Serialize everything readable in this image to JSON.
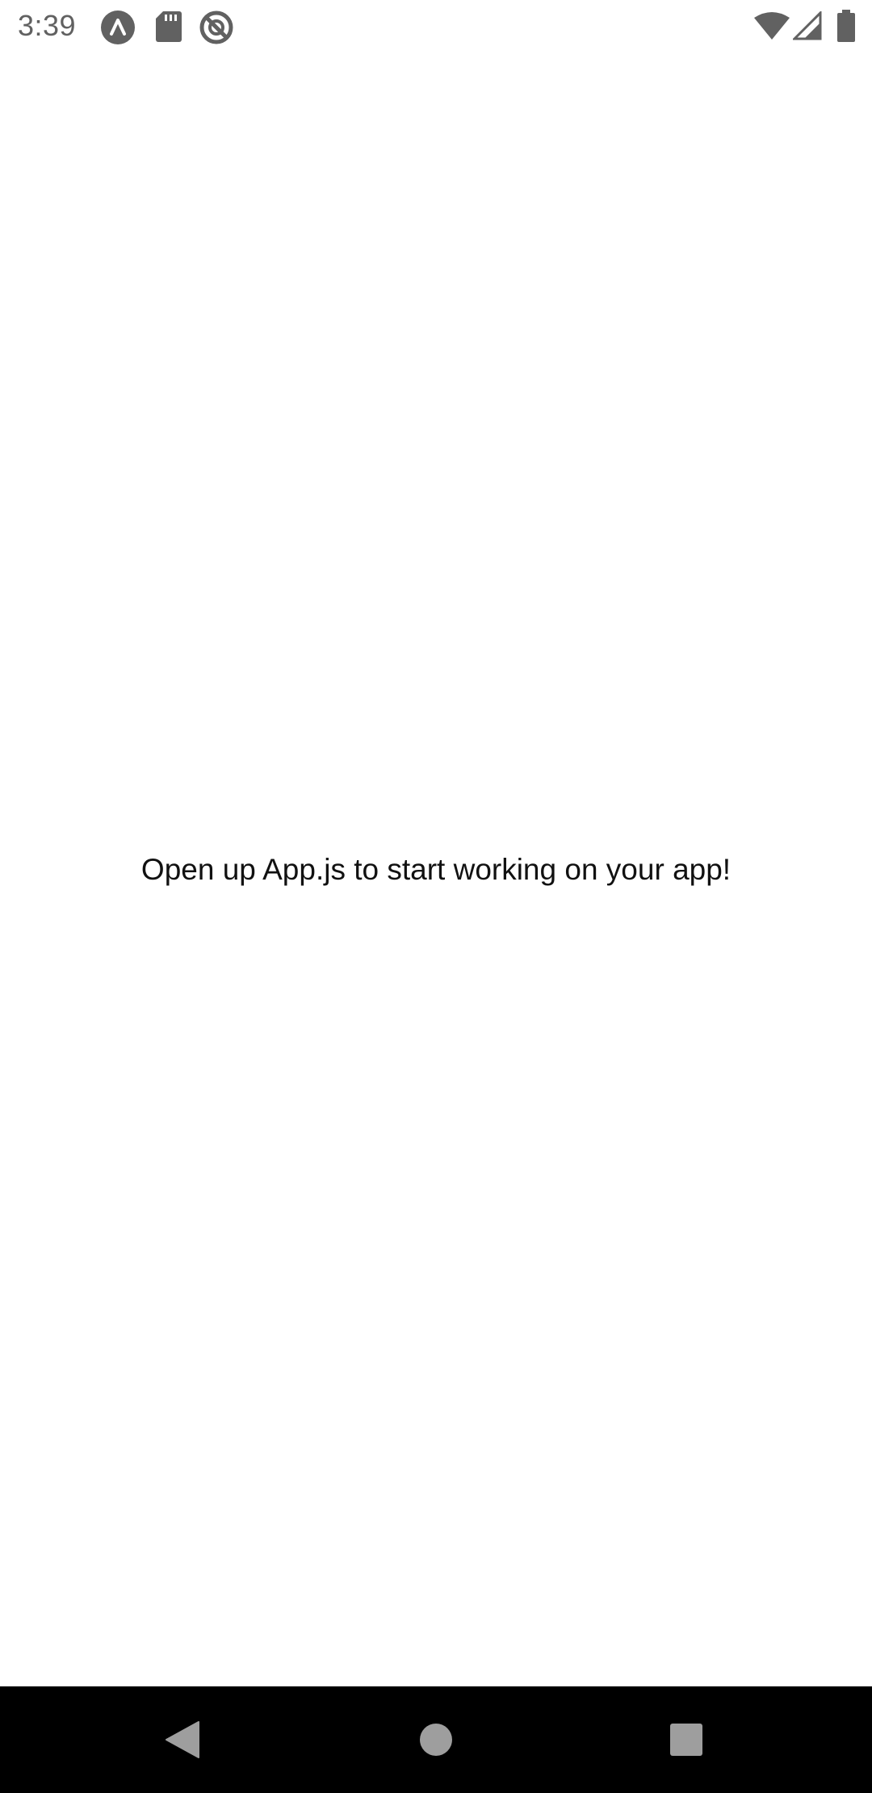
{
  "status_bar": {
    "time": "3:39",
    "left_icons": [
      "expo-notification-icon",
      "sd-card-icon",
      "do-not-disturb-icon"
    ],
    "right_icons": [
      "wifi-icon",
      "cellular-signal-icon",
      "battery-icon"
    ]
  },
  "app": {
    "message": "Open up App.js to start working on your app!"
  },
  "nav_bar": {
    "buttons": [
      "back-icon",
      "home-icon",
      "recents-icon"
    ]
  },
  "colors": {
    "background": "#ffffff",
    "status_icon": "#616161",
    "text": "#111111",
    "nav_background": "#000000",
    "nav_icon": "#9e9e9e"
  }
}
